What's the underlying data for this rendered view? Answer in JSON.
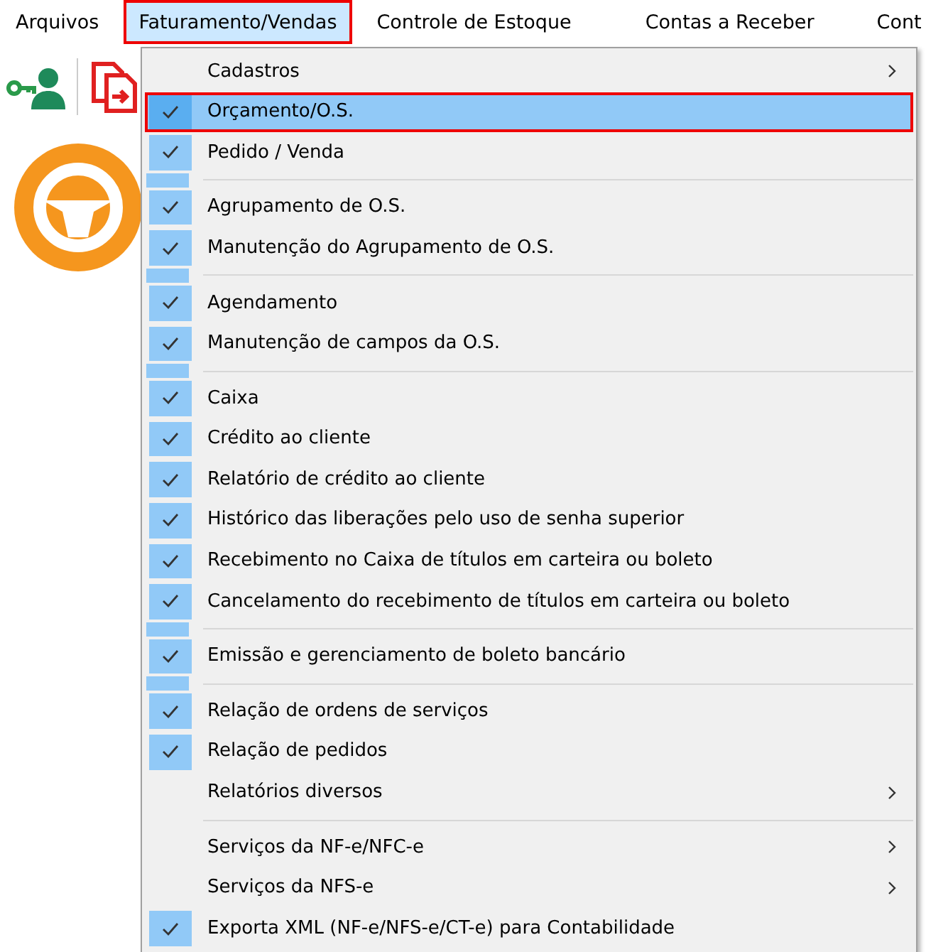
{
  "menubar": [
    {
      "label": "Arquivos",
      "selected": false,
      "annotated": false
    },
    {
      "label": "Faturamento/Vendas",
      "selected": true,
      "annotated": true
    },
    {
      "label": "Controle de Estoque",
      "selected": false,
      "annotated": false
    },
    {
      "label": "Contas a Receber",
      "selected": false,
      "annotated": false
    },
    {
      "label": "Cont",
      "selected": false,
      "annotated": false
    }
  ],
  "menu": [
    {
      "kind": "item",
      "label": "Cadastros",
      "checked": false,
      "selected": false,
      "annotated": false,
      "submenu": true
    },
    {
      "kind": "item",
      "label": "Orçamento/O.S.",
      "checked": true,
      "selected": true,
      "annotated": true,
      "submenu": false
    },
    {
      "kind": "item",
      "label": "Pedido / Venda",
      "checked": true,
      "selected": false,
      "annotated": false,
      "submenu": false
    },
    {
      "kind": "separator"
    },
    {
      "kind": "item",
      "label": "Agrupamento de O.S.",
      "checked": true,
      "selected": false,
      "annotated": false,
      "submenu": false
    },
    {
      "kind": "item",
      "label": "Manutenção do Agrupamento de O.S.",
      "checked": true,
      "selected": false,
      "annotated": false,
      "submenu": false
    },
    {
      "kind": "separator"
    },
    {
      "kind": "item",
      "label": "Agendamento",
      "checked": true,
      "selected": false,
      "annotated": false,
      "submenu": false
    },
    {
      "kind": "item",
      "label": "Manutenção de campos da O.S.",
      "checked": true,
      "selected": false,
      "annotated": false,
      "submenu": false
    },
    {
      "kind": "separator"
    },
    {
      "kind": "item",
      "label": "Caixa",
      "checked": true,
      "selected": false,
      "annotated": false,
      "submenu": false
    },
    {
      "kind": "item",
      "label": "Crédito ao cliente",
      "checked": true,
      "selected": false,
      "annotated": false,
      "submenu": false
    },
    {
      "kind": "item",
      "label": "Relatório de crédito ao cliente",
      "checked": true,
      "selected": false,
      "annotated": false,
      "submenu": false
    },
    {
      "kind": "item",
      "label": "Histórico das liberações pelo uso de senha superior",
      "checked": true,
      "selected": false,
      "annotated": false,
      "submenu": false
    },
    {
      "kind": "item",
      "label": "Recebimento no Caixa de títulos em carteira ou boleto",
      "checked": true,
      "selected": false,
      "annotated": false,
      "submenu": false
    },
    {
      "kind": "item",
      "label": "Cancelamento do recebimento de títulos em carteira ou boleto",
      "checked": true,
      "selected": false,
      "annotated": false,
      "submenu": false
    },
    {
      "kind": "separator"
    },
    {
      "kind": "item",
      "label": "Emissão e gerenciamento de boleto bancário",
      "checked": true,
      "selected": false,
      "annotated": false,
      "submenu": false
    },
    {
      "kind": "separator"
    },
    {
      "kind": "item",
      "label": "Relação de ordens de serviços",
      "checked": true,
      "selected": false,
      "annotated": false,
      "submenu": false
    },
    {
      "kind": "item",
      "label": "Relação de pedidos",
      "checked": true,
      "selected": false,
      "annotated": false,
      "submenu": false
    },
    {
      "kind": "item",
      "label": "Relatórios diversos",
      "checked": false,
      "selected": false,
      "annotated": false,
      "submenu": true
    },
    {
      "kind": "separator"
    },
    {
      "kind": "item",
      "label": "Serviços da NF-e/NFC-e",
      "checked": false,
      "selected": false,
      "annotated": false,
      "submenu": true
    },
    {
      "kind": "item",
      "label": "Serviços da NFS-e",
      "checked": false,
      "selected": false,
      "annotated": false,
      "submenu": true
    },
    {
      "kind": "item",
      "label": "Exporta XML (NF-e/NFS-e/CT-e) para Contabilidade",
      "checked": true,
      "selected": false,
      "annotated": false,
      "submenu": false
    }
  ]
}
